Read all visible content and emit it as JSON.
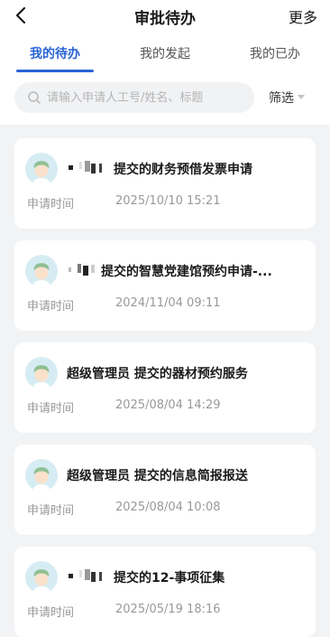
{
  "header": {
    "title": "审批待办",
    "more_label": "更多"
  },
  "tabs": [
    {
      "label": "我的待办",
      "active": true
    },
    {
      "label": "我的发起",
      "active": false
    },
    {
      "label": "我的已办",
      "active": false
    }
  ],
  "search": {
    "placeholder": "请输入申请人工号/姓名、标题",
    "filter_label": "筛选"
  },
  "accent_color": "#2a64d6",
  "items": [
    {
      "title": "提交的财务预借发票申请",
      "time_label": "申请时间",
      "time": "2025/10/10 15:21",
      "submitter_redacted": true
    },
    {
      "title": "提交的智慧党建馆预约申请-...",
      "time_label": "申请时间",
      "time": "2024/11/04 09:11",
      "submitter_redacted": true
    },
    {
      "title": "超级管理员 提交的器材预约服务",
      "time_label": "申请时间",
      "time": "2025/08/04 14:29",
      "submitter_redacted": false
    },
    {
      "title": "超级管理员 提交的信息简报报送",
      "time_label": "申请时间",
      "time": "2025/08/04 10:08",
      "submitter_redacted": false
    },
    {
      "title": "提交的12-事项征集",
      "time_label": "申请时间",
      "time": "2025/05/19 18:16",
      "submitter_redacted": true
    }
  ]
}
